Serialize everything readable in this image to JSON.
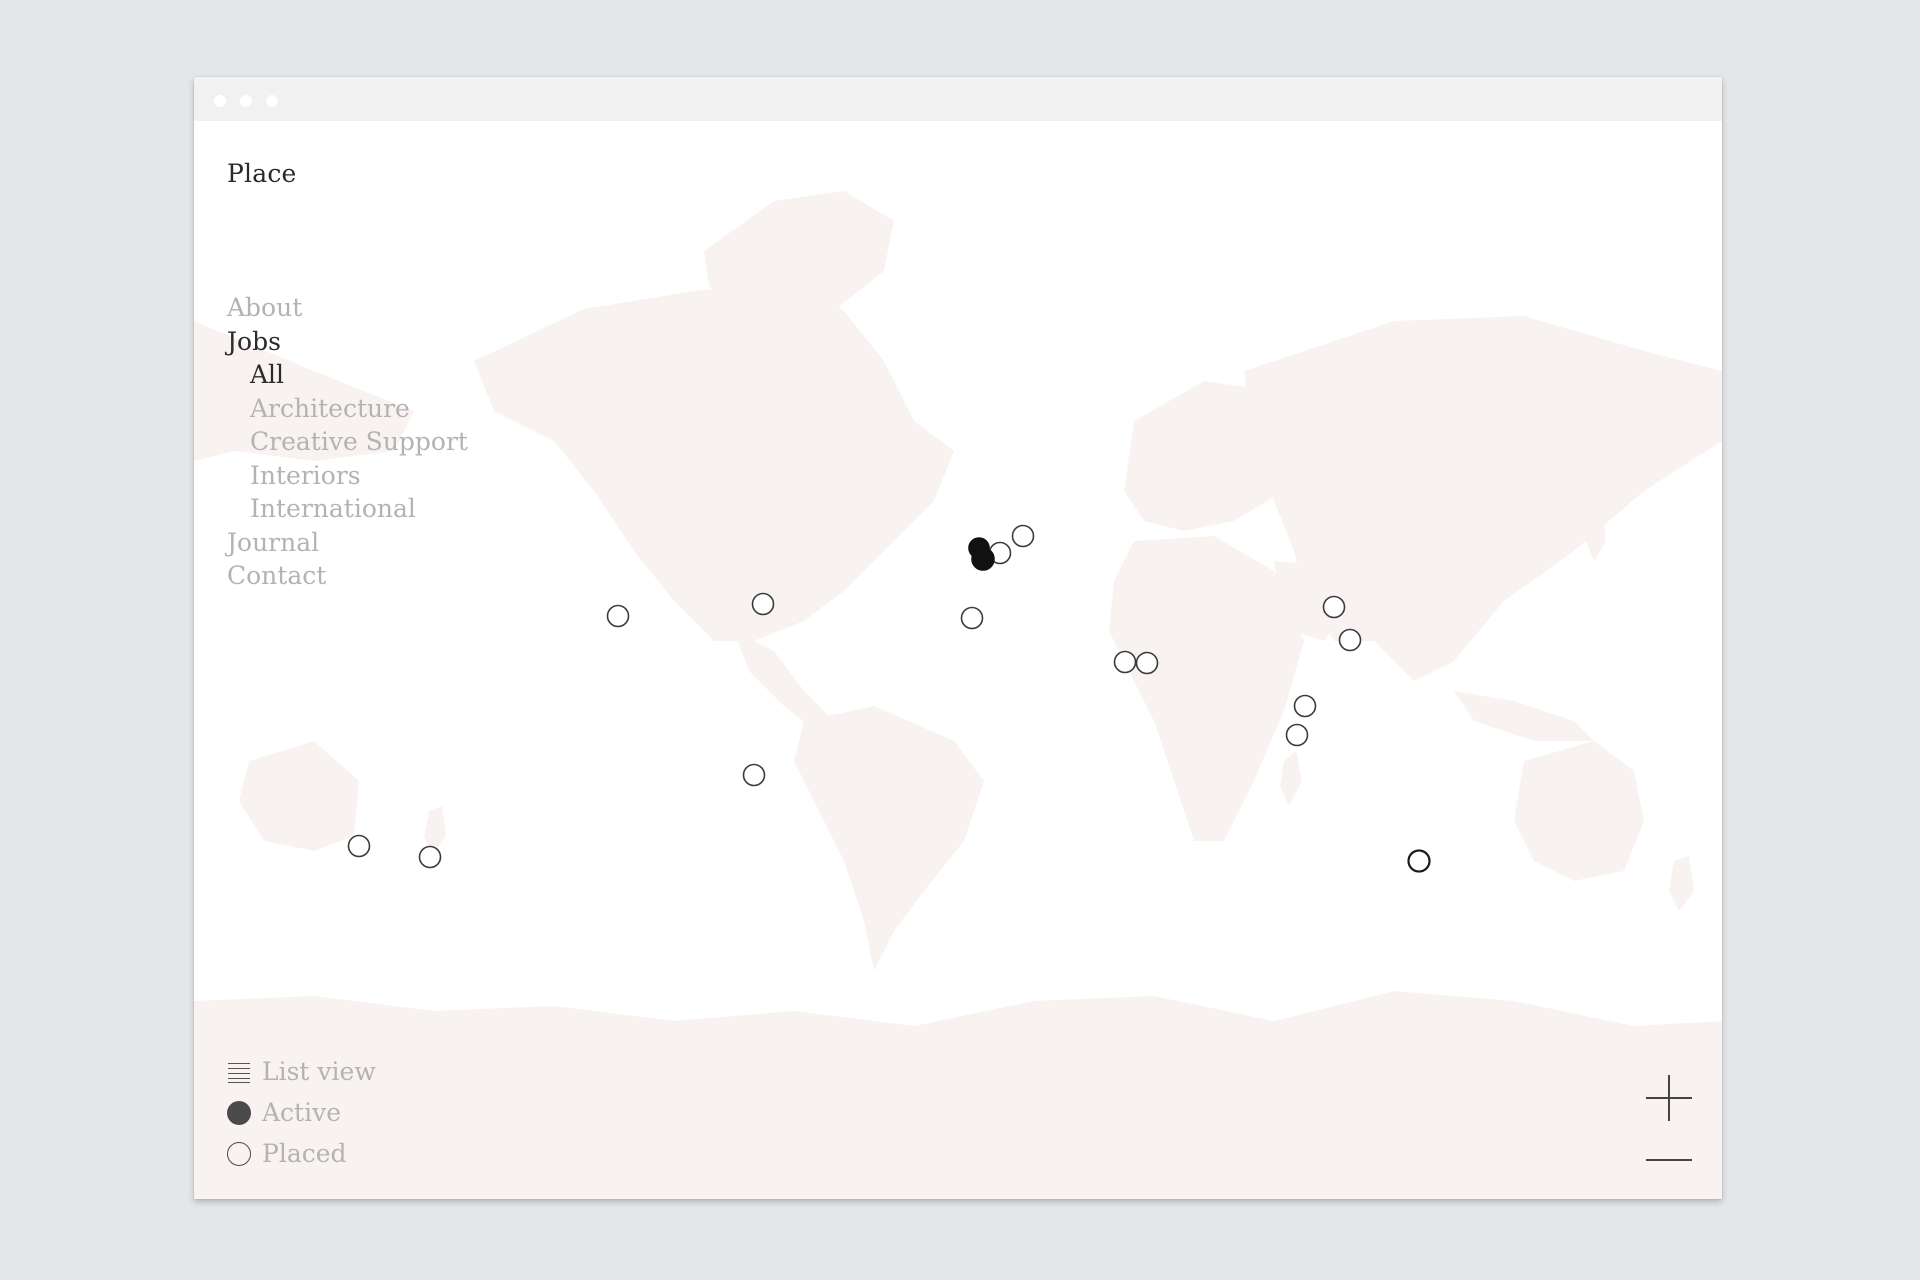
{
  "app": {
    "brand": "Place"
  },
  "nav": {
    "about": "About",
    "jobs": "Jobs",
    "jobs_sub": {
      "all": "All",
      "architecture": "Architecture",
      "creative_support": "Creative Support",
      "interiors": "Interiors",
      "international": "International"
    },
    "journal": "Journal",
    "contact": "Contact"
  },
  "legend": {
    "list_view": "List view",
    "active": "Active",
    "placed": "Placed"
  },
  "controls": {
    "zoom_in_icon": "plus-icon",
    "zoom_out_icon": "minus-icon"
  },
  "colors": {
    "land": "#f8f3f1",
    "marker_stroke": "#3a3a3a",
    "active_marker": "#111111",
    "nav_muted": "#b3b3b3",
    "nav_active": "#2b2b2b"
  }
}
